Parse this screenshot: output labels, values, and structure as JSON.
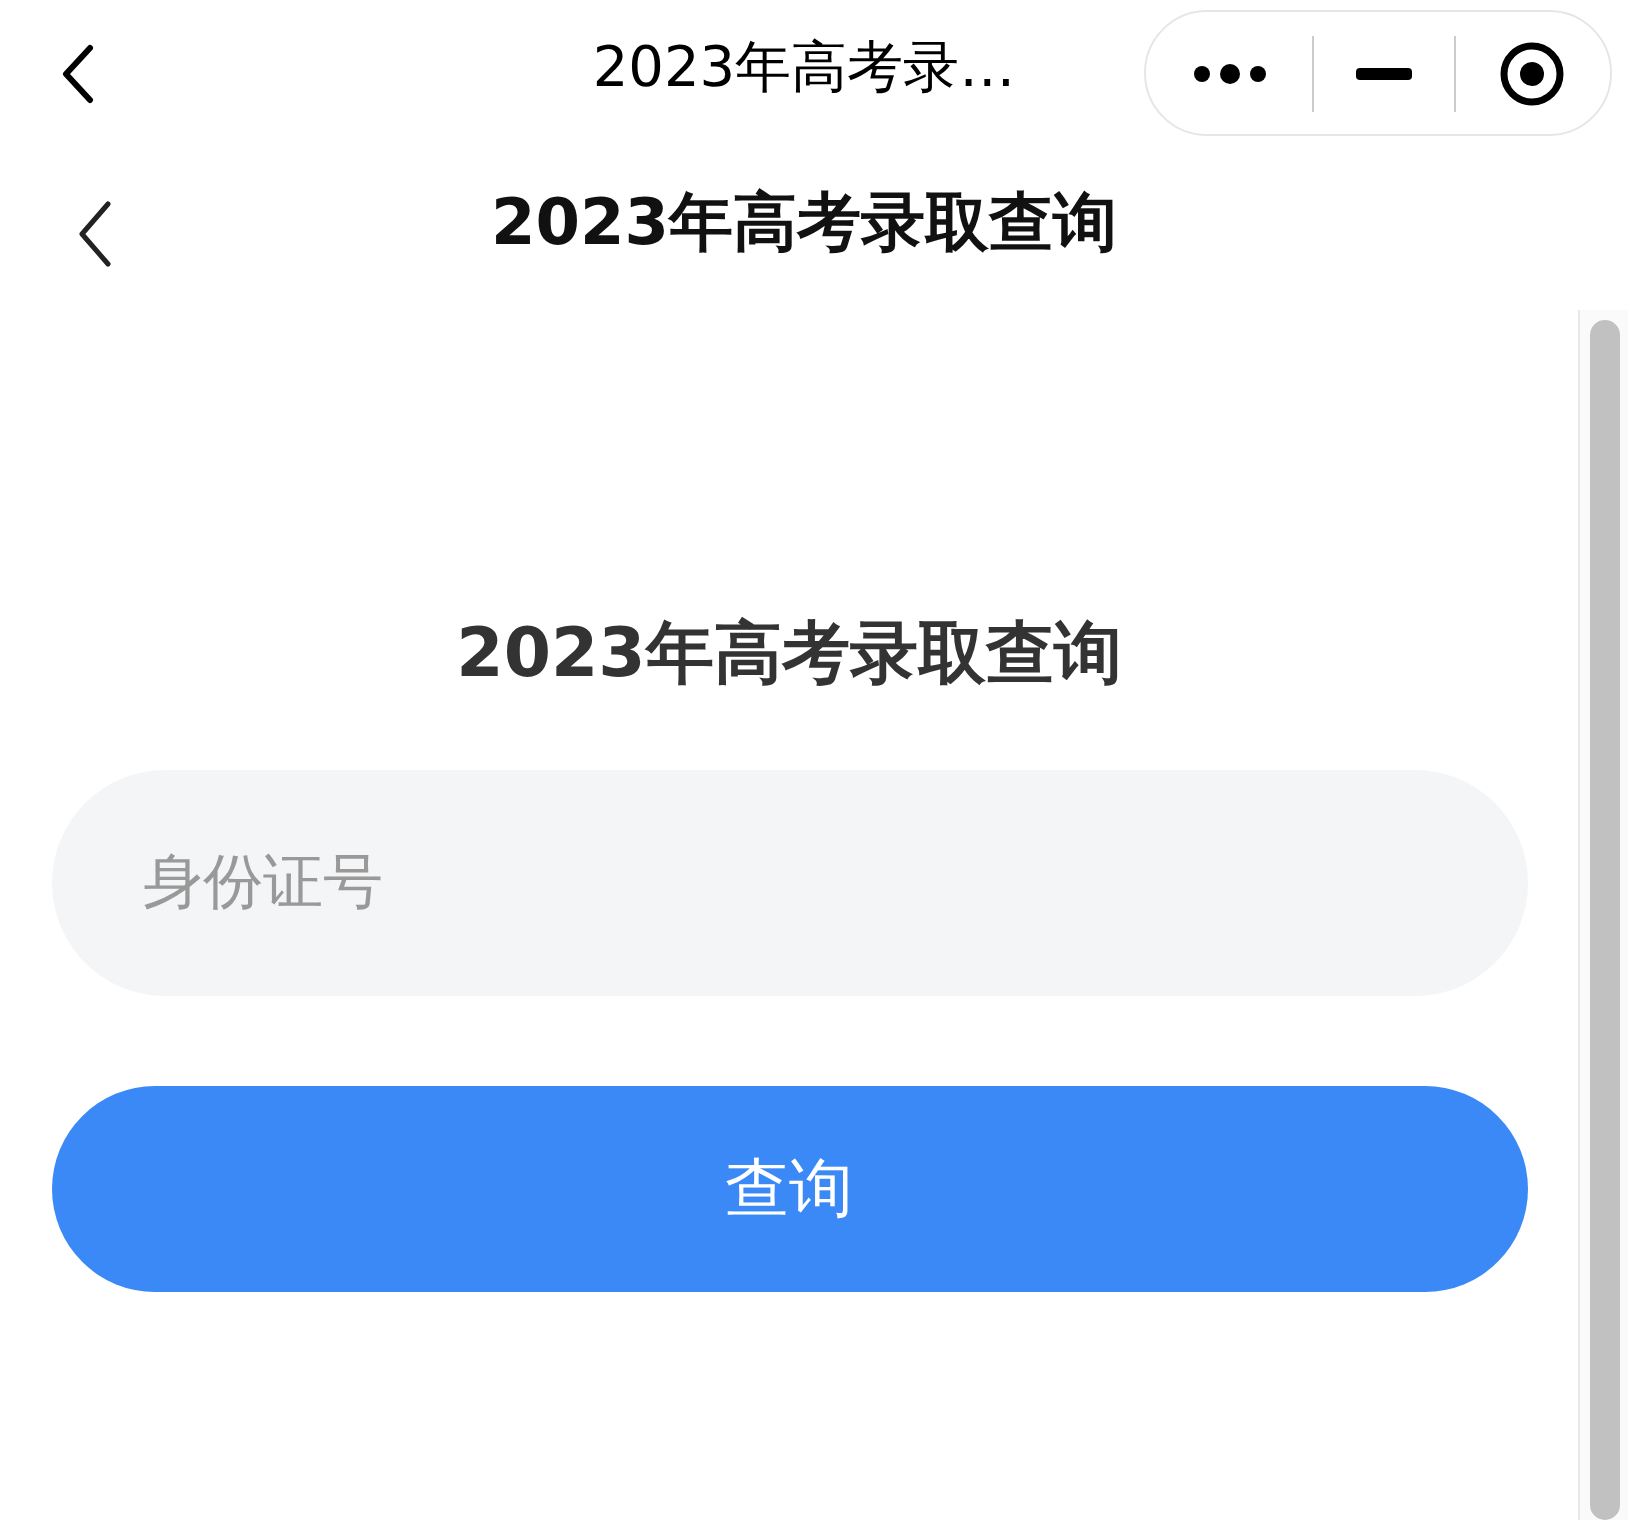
{
  "top_bar": {
    "title": "2023年高考录…"
  },
  "nav_bar": {
    "title": "2023年高考录取查询"
  },
  "form": {
    "heading": "2023年高考录取查询",
    "id_field": {
      "placeholder": "身份证号"
    },
    "submit_button": "查询"
  }
}
